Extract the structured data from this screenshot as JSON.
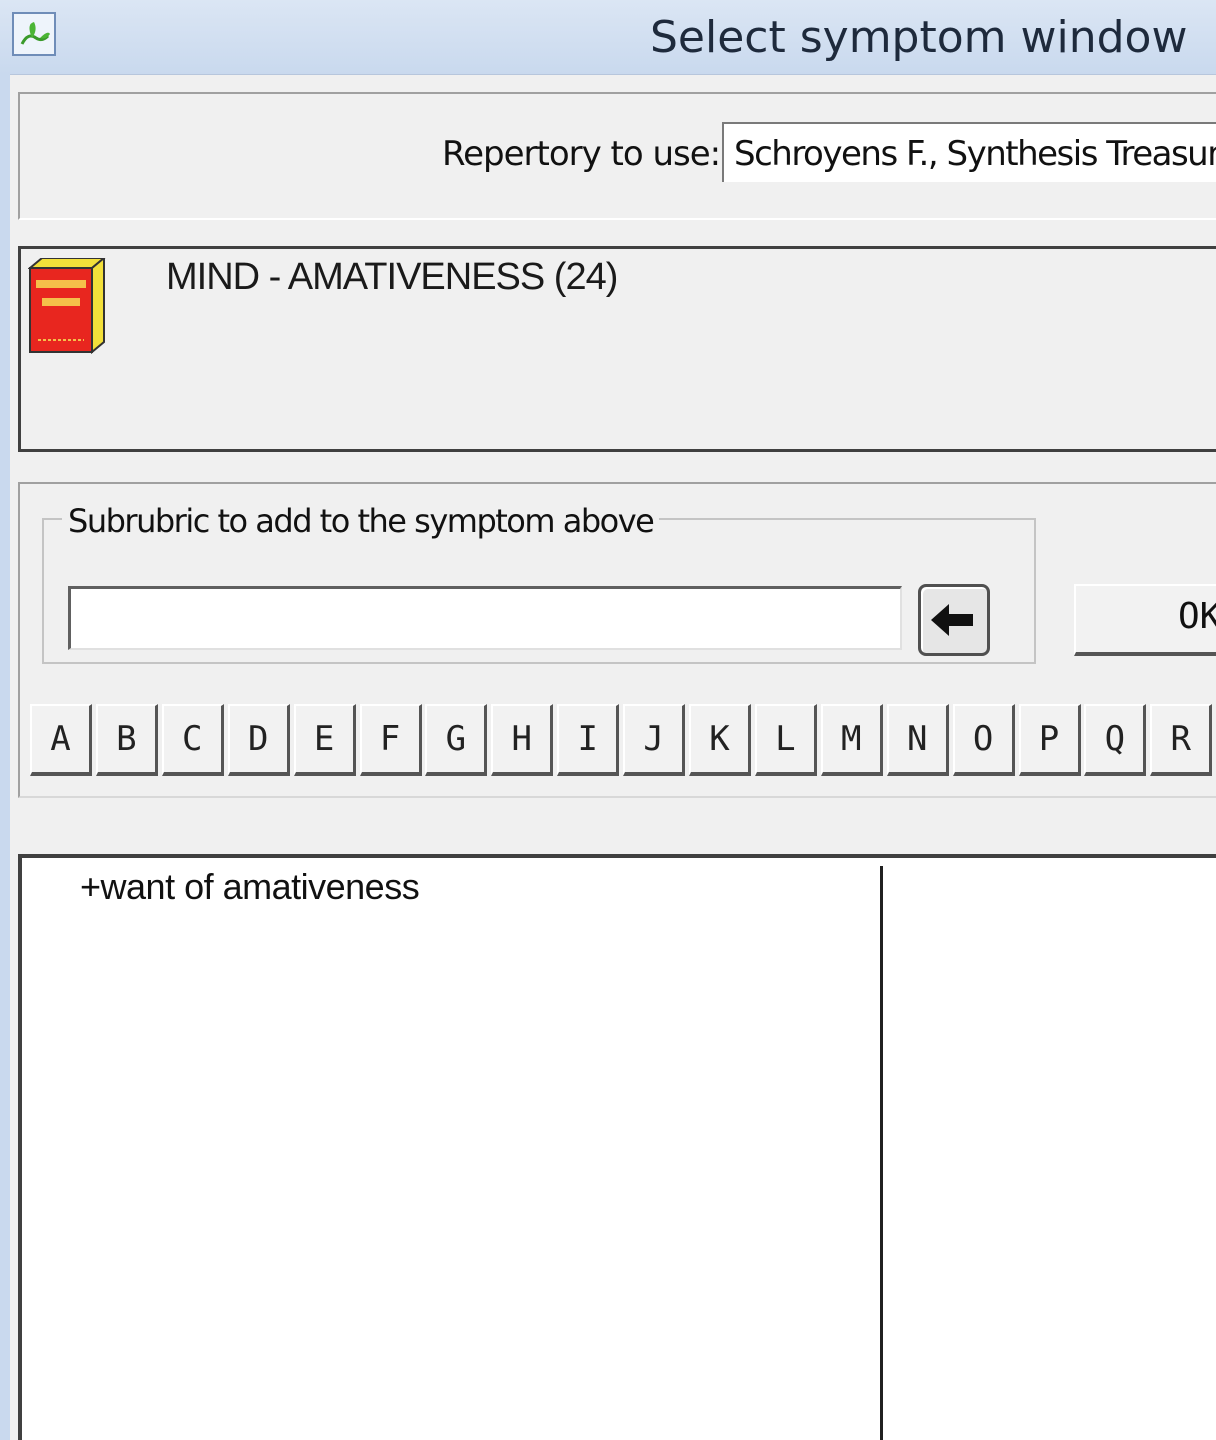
{
  "window": {
    "title": "Select symptom window",
    "icon": "app-leaf-icon"
  },
  "repertory": {
    "label": "Repertory to use:",
    "value": "Schroyens F., Synthesis Treasure"
  },
  "symptom": {
    "icon": "red-book-icon",
    "text": "MIND - AMATIVENESS (24)"
  },
  "subrubric": {
    "group_label": "Subrubric to add to the symptom above",
    "input_value": "",
    "arrow_button_icon": "arrow-left-icon",
    "ok_label": "OK"
  },
  "letters": [
    "A",
    "B",
    "C",
    "D",
    "E",
    "F",
    "G",
    "H",
    "I",
    "J",
    "K",
    "L",
    "M",
    "N",
    "O",
    "P",
    "Q",
    "R"
  ],
  "list": {
    "items": [
      "+want of amativeness"
    ]
  },
  "colors": {
    "titlebar": "#c9d9ee",
    "book_red": "#e8261f",
    "book_yellow": "#f3e03a"
  }
}
